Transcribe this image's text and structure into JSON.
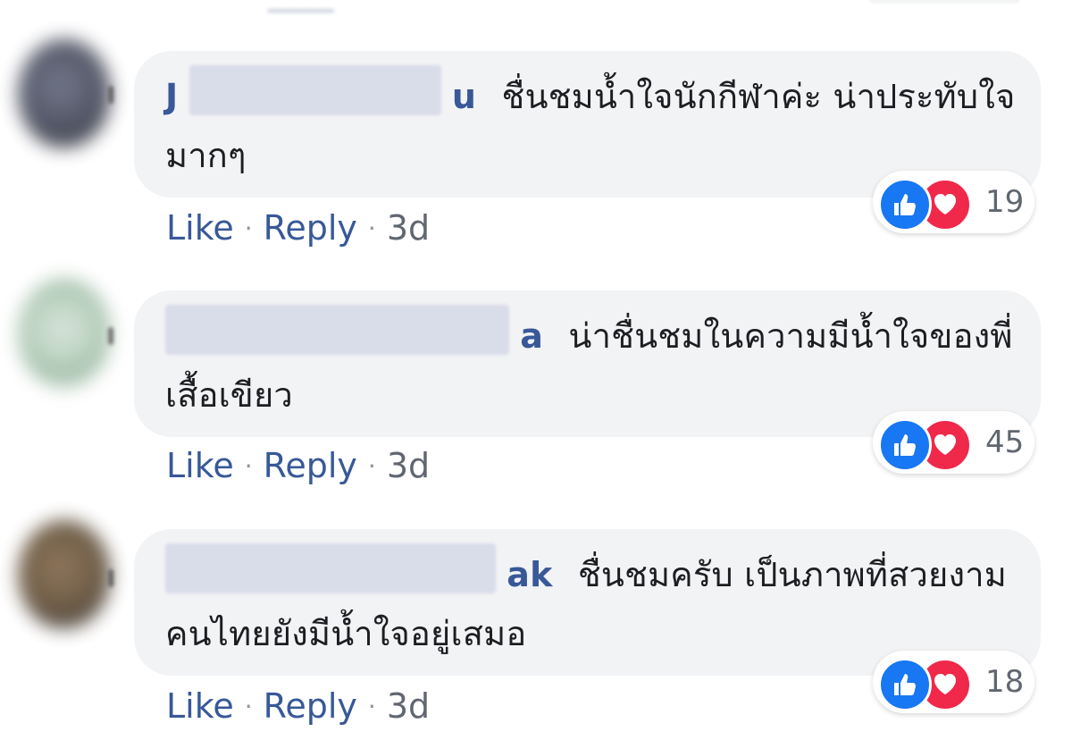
{
  "comments": [
    {
      "name_prefix": "J",
      "name_suffix": "u",
      "text_line1": "ชื่นชมน้ำใจนักกีฬาค่ะ น่าประทับใจ",
      "text_line2": "มากๆ",
      "like_label": "Like",
      "reply_label": "Reply",
      "time": "3d",
      "reaction_count": "19"
    },
    {
      "name_prefix": "",
      "name_suffix": "a",
      "text_line1": "น่าชื่นชมในความมีน้ำใจของพี่",
      "text_line2": "เสื้อเขียว",
      "like_label": "Like",
      "reply_label": "Reply",
      "time": "3d",
      "reaction_count": "45"
    },
    {
      "name_prefix": "",
      "name_suffix": "ak",
      "text_line1": "ชื่นชมครับ เป็นภาพที่สวยงาม",
      "text_line2": "คนไทยยังมีน้ำใจอยู่เสมอ",
      "like_label": "Like",
      "reply_label": "Reply",
      "time": "3d",
      "reaction_count": "18"
    }
  ],
  "icons": {
    "like": "thumbs-up-icon",
    "love": "heart-icon"
  },
  "colors": {
    "link": "#385898",
    "bubble": "#f2f3f5",
    "like_blue": "#1877f2",
    "love_red": "#f02849"
  }
}
